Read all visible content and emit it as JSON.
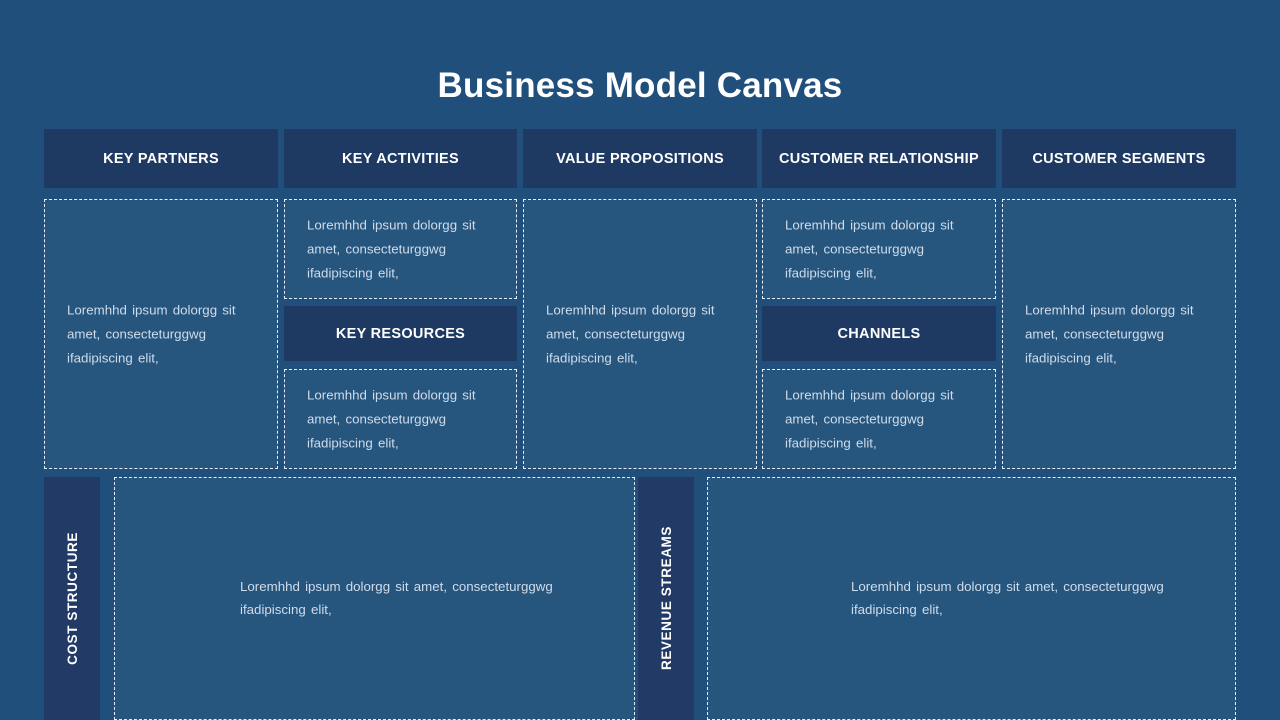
{
  "page": {
    "title": "Business Model Canvas",
    "background_color": "#1f4f7a",
    "header_color": "#1e3a63",
    "text_color": "#cfdcea",
    "accent_color": "#ffffff"
  },
  "body_text": {
    "three_line": "Loremhhd ipsum dolorgg sit amet, consecteturggwg ifadipiscing elit,",
    "two_line": "Loremhhd ipsum dolorgg sit amet, consecteturggwg ifadipiscing elit,"
  },
  "columns": [
    {
      "key": "key_partners",
      "header": "KEY PARTNERS"
    },
    {
      "key": "key_activities",
      "header": "KEY ACTIVITIES"
    },
    {
      "key": "value_propositions",
      "header": "VALUE PROPOSITIONS"
    },
    {
      "key": "customer_relationship",
      "header": "CUSTOMER RELATIONSHIP"
    },
    {
      "key": "customer_segments",
      "header": "CUSTOMER SEGMENTS"
    }
  ],
  "sub_headers": {
    "key_resources": "KEY RESOURCES",
    "channels": "CHANNELS"
  },
  "cells": {
    "key_partners": {
      "text": "Loremhhd ipsum dolorgg sit amet, consecteturggwg ifadipiscing elit,"
    },
    "key_activities_top": {
      "text": "Loremhhd ipsum dolorgg sit amet, consecteturggwg ifadipiscing elit,"
    },
    "key_resources_bottom": {
      "text": "Loremhhd ipsum dolorgg sit amet, consecteturggwg ifadipiscing elit,"
    },
    "value_propositions": {
      "text": "Loremhhd ipsum dolorgg sit amet, consecteturggwg ifadipiscing elit,"
    },
    "customer_relationship": {
      "text": "Loremhhd ipsum dolorgg sit amet, consecteturggwg ifadipiscing elit,"
    },
    "channels_bottom": {
      "text": "Loremhhd ipsum dolorgg sit amet, consecteturggwg ifadipiscing elit,"
    },
    "customer_segments": {
      "text": "Loremhhd ipsum dolorgg sit amet, consecteturggwg ifadipiscing elit,"
    }
  },
  "bottom": {
    "cost_structure": {
      "label": "COST STRUCTURE",
      "text": "Loremhhd ipsum dolorgg sit amet, consecteturggwg ifadipiscing elit,"
    },
    "revenue_streams": {
      "label": "REVENUE STREAMS",
      "text": "Loremhhd ipsum dolorgg sit amet, consecteturggwg ifadipiscing elit,"
    }
  }
}
